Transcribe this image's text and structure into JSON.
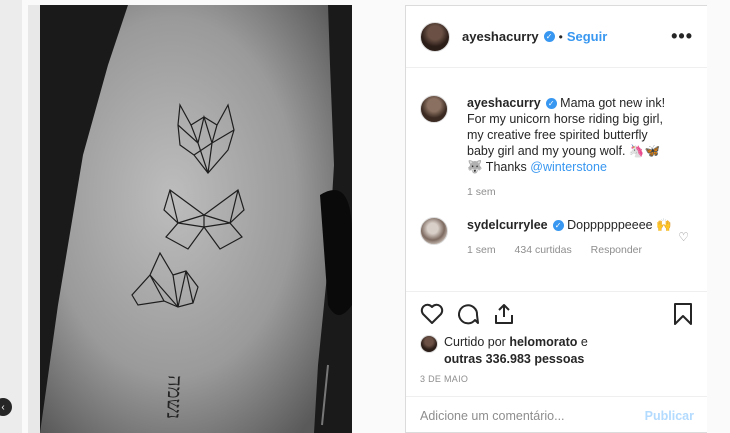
{
  "post": {
    "username": "ayeshacurry",
    "follow_label": "Seguir",
    "more_label": "•••",
    "caption": {
      "username": "ayeshacurry",
      "text": "Mama got new ink! For my unicorn horse riding big girl, my creative free spirited butterfly baby girl and my young wolf. 🦄🦋 🐺 Thanks ",
      "mention": "@winterstone",
      "time": "1 sem"
    },
    "comments": [
      {
        "username": "sydelcurrylee",
        "text": "Doppppppeeee 🙌",
        "time": "1 sem",
        "likes": "434 curtidas",
        "reply": "Responder"
      }
    ],
    "liked_by_prefix": "Curtido por ",
    "liked_by_user": "helomorato",
    "liked_by_suffix": " e",
    "liked_by_others": "outras 336.983 pessoas",
    "date": "3 DE MAIO",
    "comment_placeholder": "Adicione um comentário...",
    "publish_label": "Publicar"
  },
  "photo": {
    "tattoo_text": "נשמה"
  },
  "colors": {
    "link": "#3897f0",
    "muted": "#8e8e8e",
    "publish_disabled": "#b3dbff"
  },
  "icons": [
    "heart-icon",
    "comment-icon",
    "share-icon",
    "bookmark-icon",
    "verified-icon",
    "more-icon"
  ]
}
